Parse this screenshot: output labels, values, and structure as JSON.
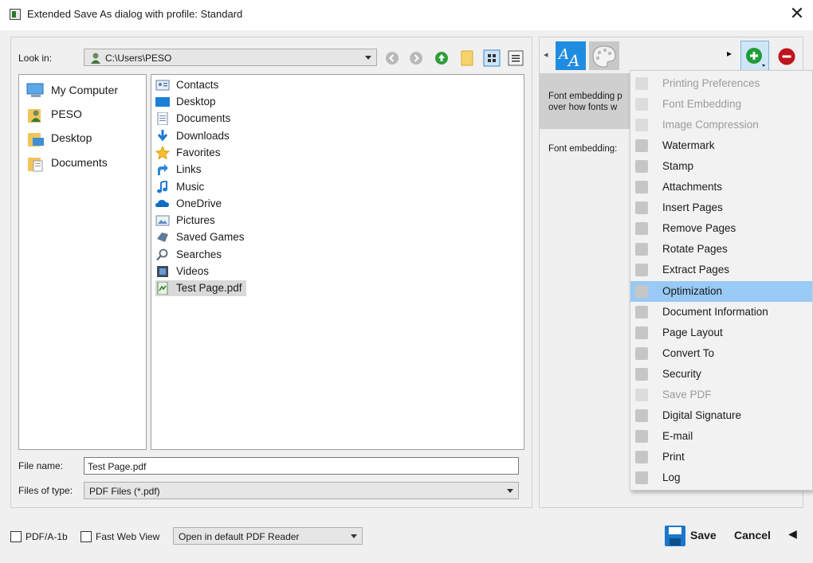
{
  "window": {
    "title": "Extended Save As dialog with profile: Standard",
    "close_glyph": "✕"
  },
  "lookin": {
    "label": "Look in:",
    "path": "C:\\Users\\PESO"
  },
  "places": [
    {
      "label": "My Computer",
      "icon": "computer-icon"
    },
    {
      "label": "PESO",
      "icon": "user-folder-icon"
    },
    {
      "label": "Desktop",
      "icon": "desktop-folder-icon"
    },
    {
      "label": "Documents",
      "icon": "documents-folder-icon"
    }
  ],
  "files": [
    {
      "label": "Contacts",
      "icon": "contacts-icon"
    },
    {
      "label": "Desktop",
      "icon": "desktop-icon"
    },
    {
      "label": "Documents",
      "icon": "documents-icon"
    },
    {
      "label": "Downloads",
      "icon": "downloads-icon"
    },
    {
      "label": "Favorites",
      "icon": "favorites-star-icon"
    },
    {
      "label": "Links",
      "icon": "links-icon"
    },
    {
      "label": "Music",
      "icon": "music-note-icon"
    },
    {
      "label": "OneDrive",
      "icon": "onedrive-cloud-icon"
    },
    {
      "label": "Pictures",
      "icon": "pictures-icon"
    },
    {
      "label": "Saved Games",
      "icon": "saved-games-icon"
    },
    {
      "label": "Searches",
      "icon": "search-icon"
    },
    {
      "label": "Videos",
      "icon": "videos-icon"
    },
    {
      "label": "Test Page.pdf",
      "icon": "pdf-file-icon",
      "selected": true
    }
  ],
  "filename": {
    "label": "File name:",
    "value": "Test Page.pdf"
  },
  "filetype": {
    "label": "Files of type:",
    "value": "PDF Files (*.pdf)"
  },
  "right": {
    "desc_text": "Font embedding p\nover how fonts w",
    "font_embedding_label": "Font embedding:",
    "left_arrow": "◂",
    "right_arrow": "▸"
  },
  "menu": [
    {
      "label": "Printing Preferences",
      "disabled": true
    },
    {
      "label": "Font Embedding",
      "disabled": true
    },
    {
      "label": "Image Compression",
      "disabled": true
    },
    {
      "label": "Watermark"
    },
    {
      "label": "Stamp"
    },
    {
      "label": "Attachments"
    },
    {
      "label": "Insert Pages"
    },
    {
      "label": "Remove Pages"
    },
    {
      "label": "Rotate Pages"
    },
    {
      "label": "Extract Pages"
    },
    {
      "label": "Optimization",
      "selected": true
    },
    {
      "label": "Document Information"
    },
    {
      "label": "Page Layout"
    },
    {
      "label": "Convert To"
    },
    {
      "label": "Security"
    },
    {
      "label": "Save PDF",
      "disabled": true
    },
    {
      "label": "Digital Signature"
    },
    {
      "label": "E-mail"
    },
    {
      "label": "Print"
    },
    {
      "label": "Log"
    }
  ],
  "bottom": {
    "pdfa_label": "PDF/A-1b",
    "fastweb_label": "Fast Web View",
    "open_option": "Open in default PDF Reader",
    "save_label": "Save",
    "cancel_label": "Cancel",
    "collapse_arrow": "◀"
  }
}
